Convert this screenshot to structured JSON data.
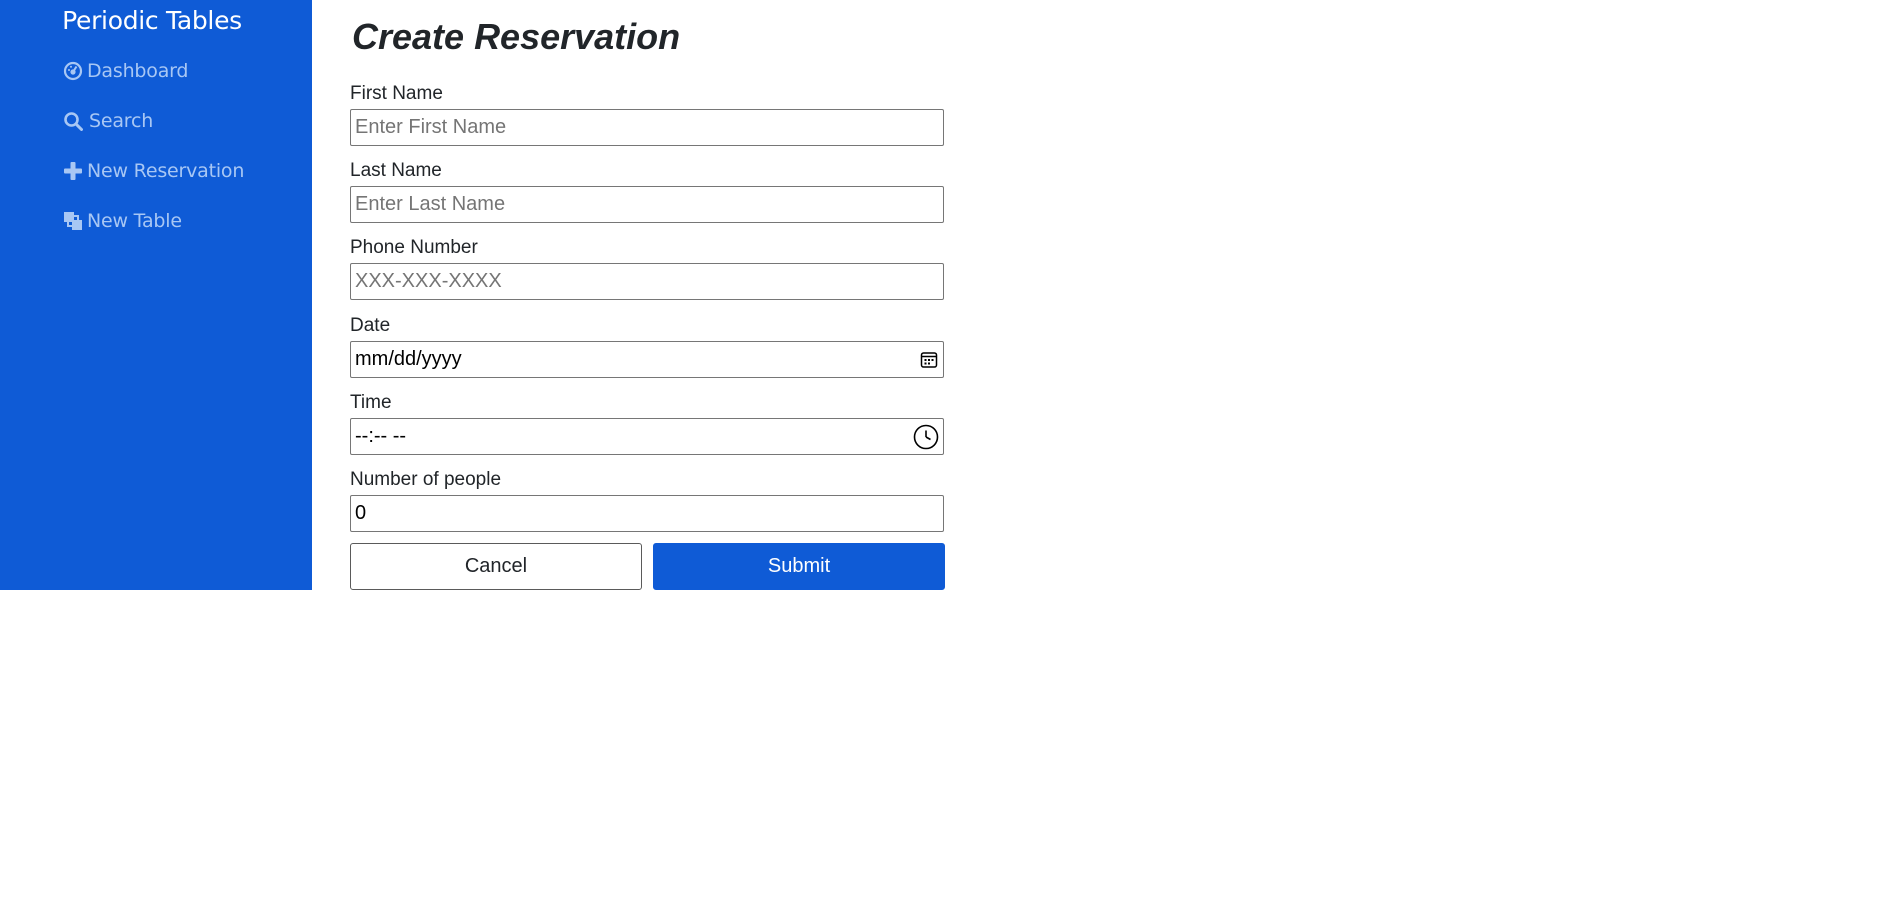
{
  "sidebar": {
    "brand": "Periodic Tables",
    "items": [
      {
        "label": "Dashboard",
        "icon": "dashboard-icon"
      },
      {
        "label": "Search",
        "icon": "search-icon"
      },
      {
        "label": "New Reservation",
        "icon": "plus-icon"
      },
      {
        "label": "New Table",
        "icon": "layers-icon"
      }
    ]
  },
  "form": {
    "title": "Create Reservation",
    "first_name": {
      "label": "First Name",
      "placeholder": "Enter First Name",
      "value": ""
    },
    "last_name": {
      "label": "Last Name",
      "placeholder": "Enter Last Name",
      "value": ""
    },
    "phone": {
      "label": "Phone Number",
      "placeholder": "XXX-XXX-XXXX",
      "value": ""
    },
    "date": {
      "label": "Date",
      "value": "mm/dd/yyyy",
      "icon": "calendar-icon"
    },
    "time": {
      "label": "Time",
      "value": "--:-- --",
      "icon": "clock-icon"
    },
    "people": {
      "label": "Number of people",
      "value": "0"
    },
    "cancel_label": "Cancel",
    "submit_label": "Submit"
  },
  "colors": {
    "primary": "#0f5bd6",
    "sidebar_text": "#a8c7f4",
    "brand_text": "#ffffff"
  }
}
